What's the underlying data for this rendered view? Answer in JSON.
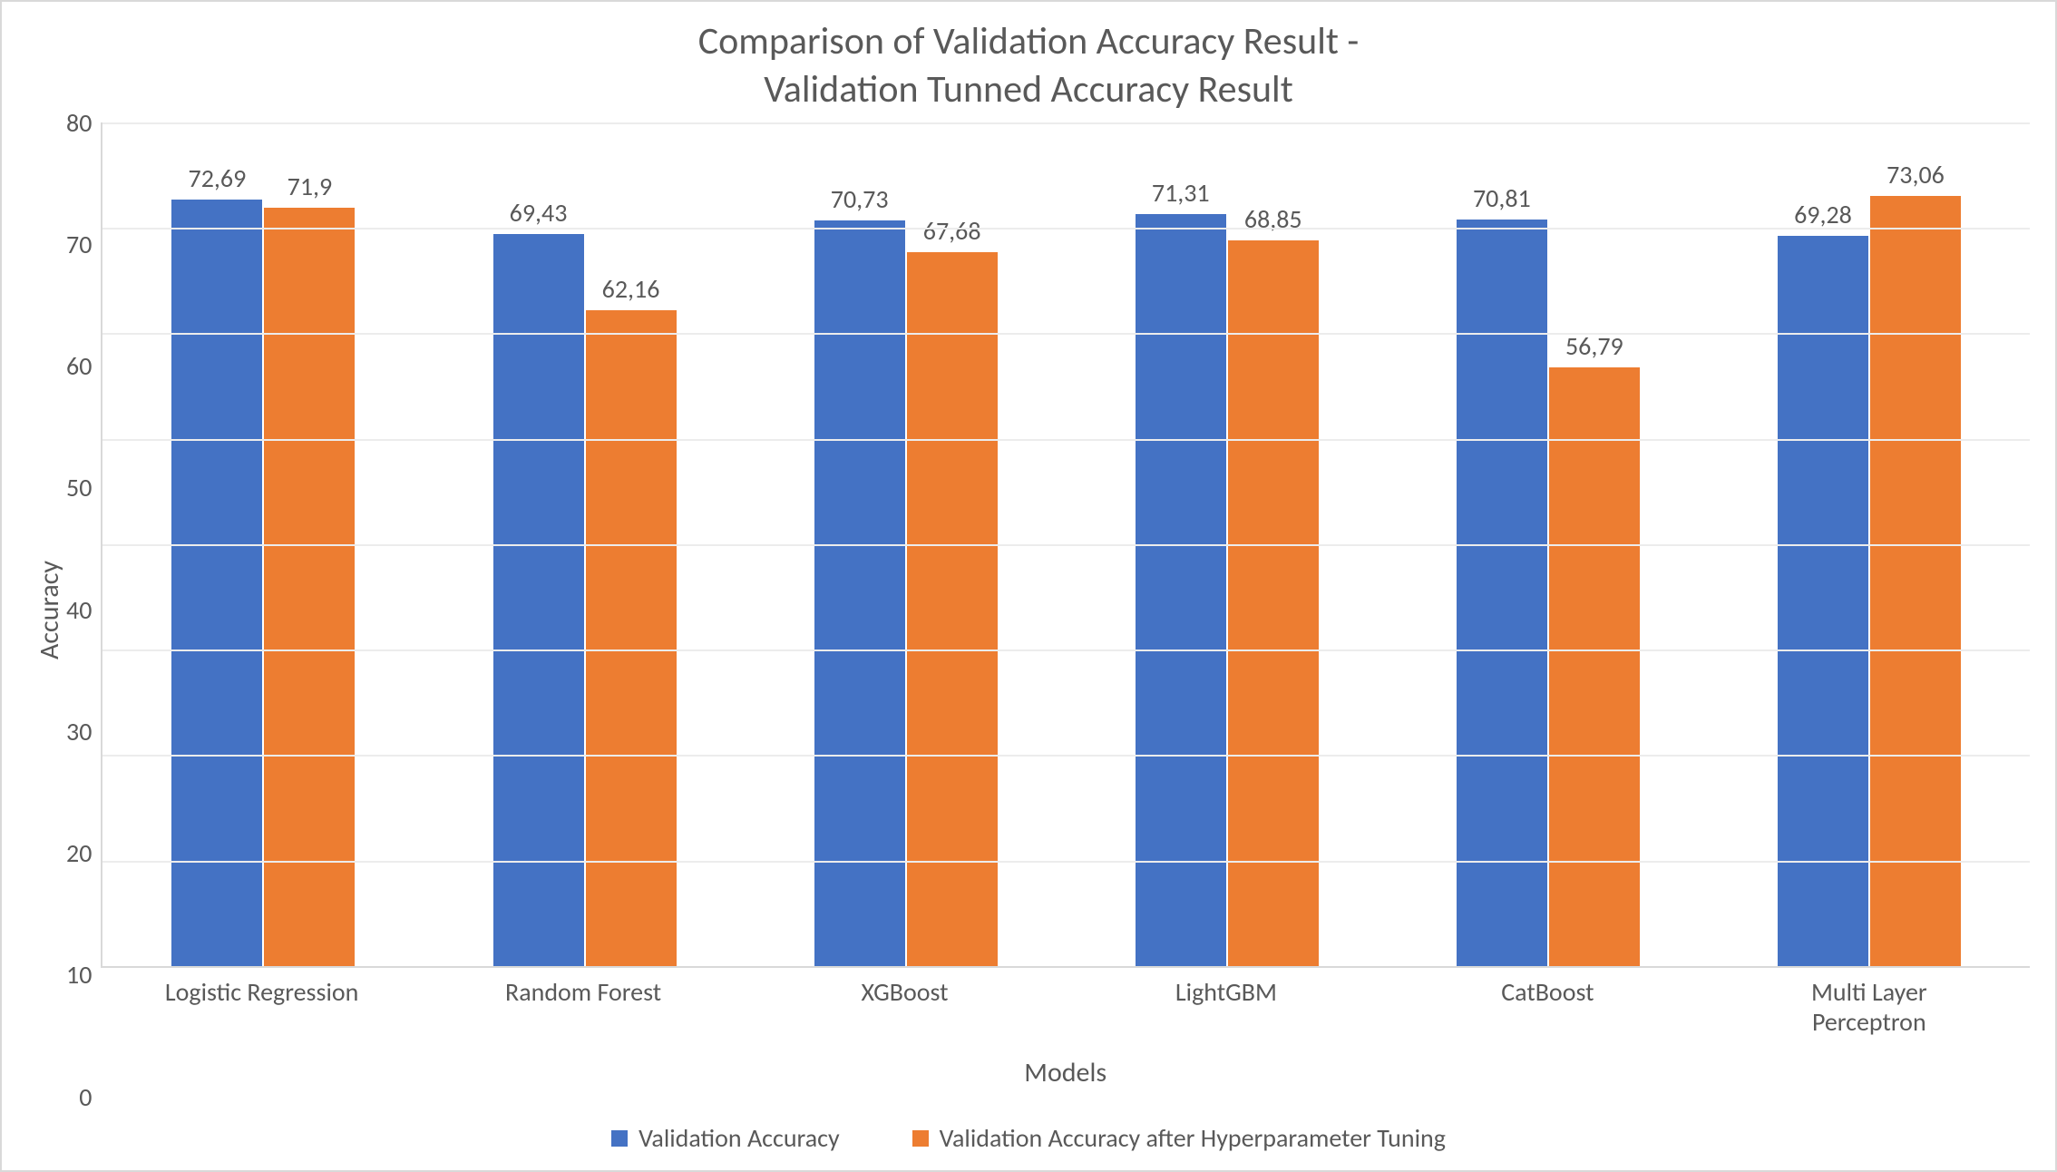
{
  "chart_data": {
    "type": "bar",
    "title_line1": "Comparison of Validation Accuracy Result -",
    "title_line2": "Validation Tunned Accuracy Result",
    "xlabel": "Models",
    "ylabel": "Accuracy",
    "ylim": [
      0,
      80
    ],
    "yticks": [
      0,
      10,
      20,
      30,
      40,
      50,
      60,
      70,
      80
    ],
    "categories": [
      "Logistic Regression",
      "Random Forest",
      "XGBoost",
      "LightGBM",
      "CatBoost",
      "Multi Layer\nPerceptron"
    ],
    "series": [
      {
        "name": "Validation Accuracy",
        "color": "#4472c4",
        "values": [
          72.69,
          69.43,
          70.73,
          71.31,
          70.81,
          69.28
        ],
        "labels": [
          "72,69",
          "69,43",
          "70,73",
          "71,31",
          "70,81",
          "69,28"
        ]
      },
      {
        "name": "Validation Accuracy after Hyperparameter Tuning",
        "color": "#ed7d31",
        "values": [
          71.9,
          62.16,
          67.68,
          68.85,
          56.79,
          73.06
        ],
        "labels": [
          "71,9",
          "62,16",
          "67,68",
          "68,85",
          "56,79",
          "73,06"
        ]
      }
    ]
  }
}
